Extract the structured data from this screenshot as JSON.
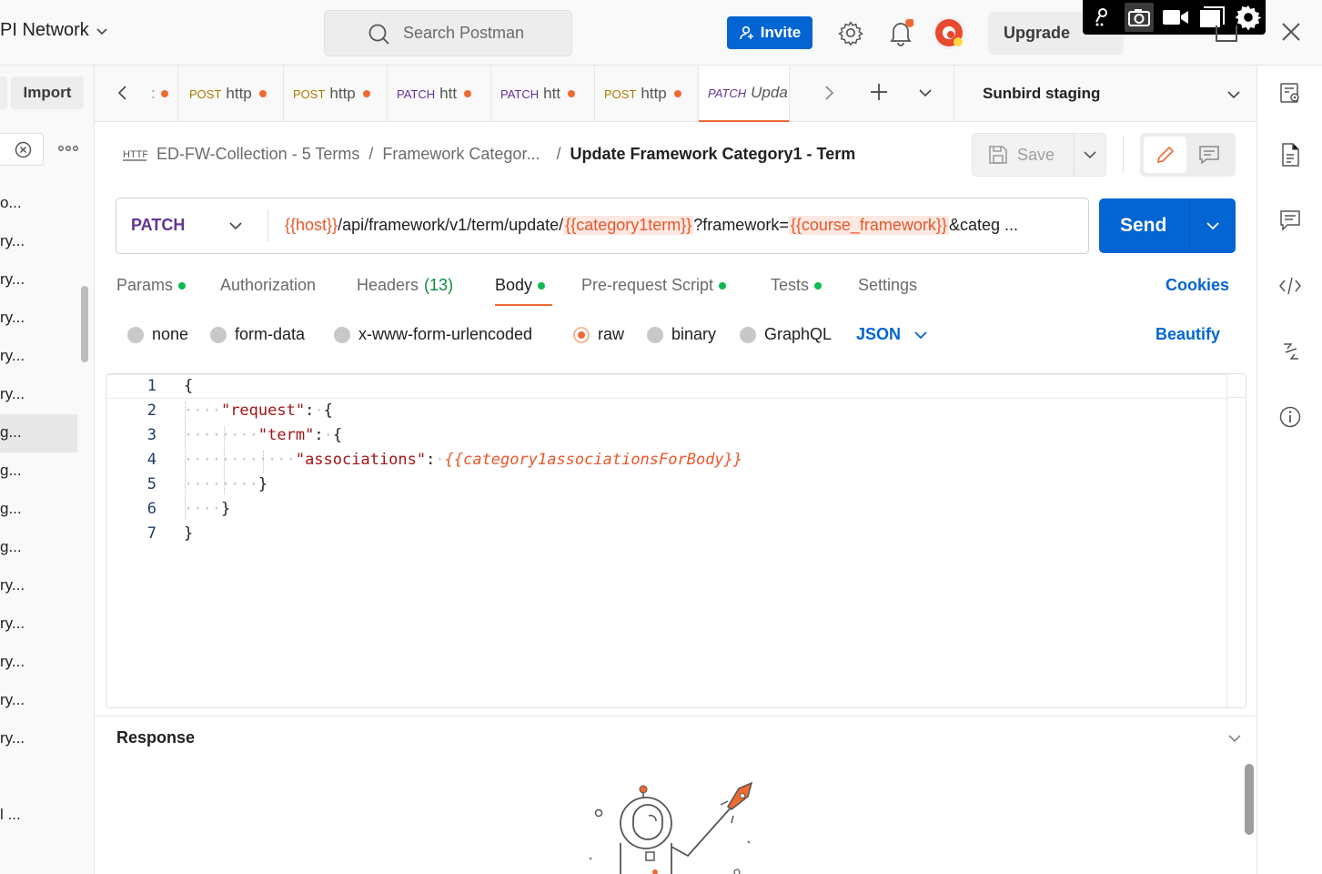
{
  "workspace": {
    "name": "PI Network"
  },
  "search": {
    "placeholder": "Search Postman"
  },
  "header": {
    "invite_label": "Invite",
    "upgrade_label": "Upgrade"
  },
  "sidebar": {
    "import_label": "Import",
    "items": [
      "o...",
      "ry...",
      "ry...",
      "ry...",
      "ry...",
      "ry...",
      "g...",
      "g...",
      "g...",
      "g...",
      "ry...",
      "ry...",
      "ry...",
      "ry...",
      "ry...",
      "l ..."
    ],
    "selected_index": 6
  },
  "tabs": [
    {
      "method": "POST",
      "label": "http"
    },
    {
      "method": "POST",
      "label": "http"
    },
    {
      "method": "PATCH",
      "label": "htt"
    },
    {
      "method": "PATCH",
      "label": "htt"
    },
    {
      "method": "POST",
      "label": "http"
    },
    {
      "method": "PATCH",
      "label": "Upda"
    }
  ],
  "environment": {
    "name": "Sunbird staging"
  },
  "breadcrumb": {
    "collection": "ED-FW-Collection - 5 Terms",
    "folder": "Framework Categor...",
    "separator": "/",
    "request": "Update Framework Category1 - Term"
  },
  "save_label": "Save",
  "request": {
    "method": "PATCH",
    "url_parts": {
      "host": "{{host}}",
      "path": "/api/framework/v1/term/update/",
      "term": "{{category1term}}",
      "query": "?framework=",
      "framework": "{{course_framework}}",
      "tail": "&categ ..."
    },
    "send_label": "Send"
  },
  "request_tabs": {
    "params": "Params",
    "authorization": "Authorization",
    "headers": "Headers",
    "headers_count": "(13)",
    "body": "Body",
    "prerequest": "Pre-request Script",
    "tests": "Tests",
    "settings": "Settings",
    "cookies": "Cookies"
  },
  "body_types": {
    "none": "none",
    "form_data": "form-data",
    "urlencoded": "x-www-form-urlencoded",
    "raw": "raw",
    "binary": "binary",
    "graphql": "GraphQL",
    "language": "JSON",
    "beautify": "Beautify"
  },
  "editor": {
    "line_numbers": [
      "1",
      "2",
      "3",
      "4",
      "5",
      "6",
      "7"
    ],
    "line1": "{",
    "key_request": "\"request\"",
    "key_term": "\"term\"",
    "key_associations": "\"associations\"",
    "value_associations": "{{category1associationsForBody}}",
    "line5": "}",
    "line6": "}",
    "line7": "}"
  },
  "response": {
    "title": "Response"
  },
  "colors": {
    "accent": "#0265d2",
    "brand": "#ef6a33",
    "patch": "#623497",
    "post": "#ad7a03"
  }
}
